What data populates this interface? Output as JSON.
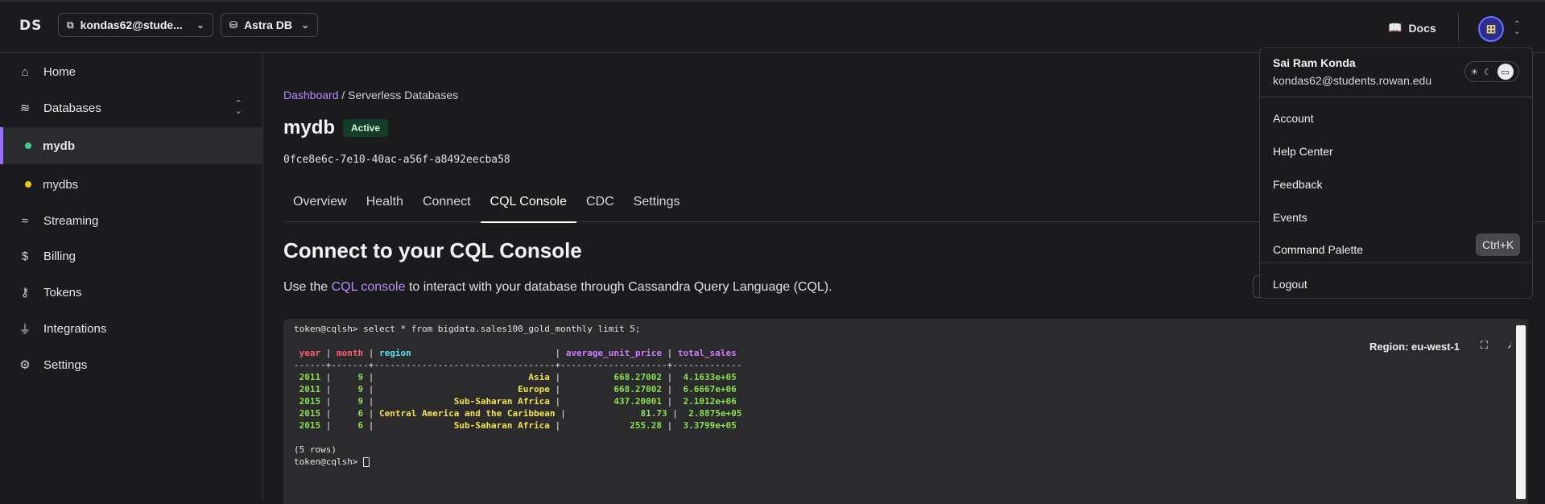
{
  "topbar": {
    "logo": "DS",
    "org_selector": "kondas62@stude...",
    "db_selector": "Astra DB",
    "docs_label": "Docs"
  },
  "sidebar": {
    "items": [
      {
        "label": "Home",
        "icon": "home-icon"
      },
      {
        "label": "Databases",
        "icon": "database-icon"
      },
      {
        "label": "mydb",
        "status_color": "#3ecf8e"
      },
      {
        "label": "mydbs",
        "status_color": "#f5c518"
      },
      {
        "label": "Streaming",
        "icon": "streaming-icon"
      },
      {
        "label": "Billing",
        "icon": "billing-icon"
      },
      {
        "label": "Tokens",
        "icon": "key-icon"
      },
      {
        "label": "Integrations",
        "icon": "plug-icon"
      },
      {
        "label": "Settings",
        "icon": "gear-icon"
      }
    ]
  },
  "main": {
    "breadcrumb_link": "Dashboard",
    "breadcrumb_rest": " / Serverless Databases",
    "db_name": "mydb",
    "status": "Active",
    "db_id": "0fce8e6c-7e10-40ac-a56f-a8492eecba58",
    "tabs": [
      "Overview",
      "Health",
      "Connect",
      "CQL Console",
      "CDC",
      "Settings"
    ],
    "active_tab": "CQL Console",
    "heading": "Connect to your CQL Console",
    "desc_pre": "Use the ",
    "desc_link": "CQL console",
    "desc_post": " to interact with your database through Cassandra Query Language (CQL)."
  },
  "console": {
    "prompt_cmd": "token@cqlsh> select * from bigdata.sales100_gold_monthly limit 5;",
    "region": "Region: eu-west-1",
    "headers": [
      "year",
      "month",
      "region",
      "average_unit_price",
      "total_sales"
    ],
    "rule": "------+-------+----------------------------------+--------------------+-------------",
    "rows": [
      [
        "2011",
        "9",
        "Asia",
        "668.27002",
        "4.1633e+05"
      ],
      [
        "2011",
        "9",
        "Europe",
        "668.27002",
        "6.6667e+06"
      ],
      [
        "2015",
        "9",
        "Sub-Saharan Africa",
        "437.20001",
        "2.1012e+06"
      ],
      [
        "2015",
        "6",
        "Central America and the Caribbean",
        "81.73",
        "2.8875e+05"
      ],
      [
        "2015",
        "6",
        "Sub-Saharan Africa",
        "255.28",
        "3.3799e+05"
      ]
    ],
    "row_count": "(5 rows)",
    "prompt": "token@cqlsh> "
  },
  "user_menu": {
    "name": "Sai Ram Konda",
    "email": "kondas62@students.rowan.edu",
    "items": [
      "Account",
      "Help Center",
      "Feedback",
      "Events",
      "Command Palette"
    ],
    "shortcut": "Ctrl+K",
    "logout": "Logout"
  }
}
